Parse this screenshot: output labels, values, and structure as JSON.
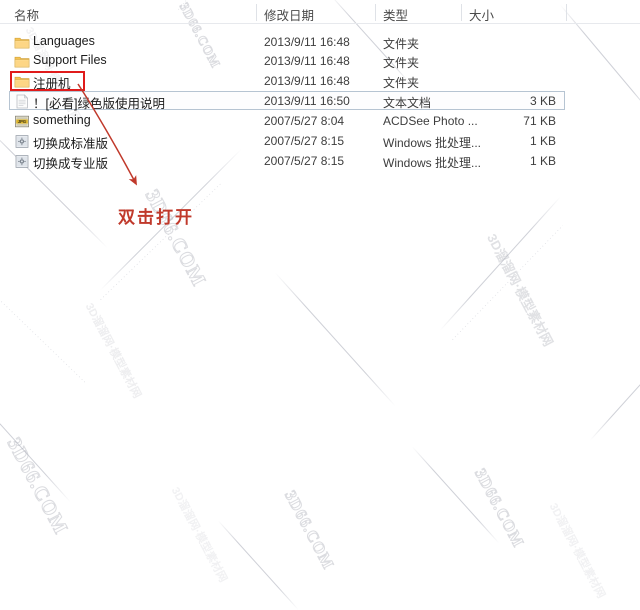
{
  "window": {
    "title": "Windows Explorer file list"
  },
  "columns": [
    {
      "key": "name",
      "label": "名称"
    },
    {
      "key": "date",
      "label": "修改日期"
    },
    {
      "key": "type",
      "label": "类型"
    },
    {
      "key": "size",
      "label": "大小"
    }
  ],
  "rows": [
    {
      "icon": "folder-icon",
      "name": "Languages",
      "date": "2013/9/11 16:48",
      "type": "文件夹",
      "size": "",
      "selected": false
    },
    {
      "icon": "folder-icon",
      "name": "Support Files",
      "date": "2013/9/11 16:48",
      "type": "文件夹",
      "size": "",
      "selected": false
    },
    {
      "icon": "folder-icon",
      "name": "注册机",
      "date": "2013/9/11 16:48",
      "type": "文件夹",
      "size": "",
      "selected": false
    },
    {
      "icon": "text-file-icon",
      "name": "！[必看]绿色版使用说明",
      "date": "2013/9/11 16:50",
      "type": "文本文档",
      "size": "3 KB",
      "selected": true
    },
    {
      "icon": "jpg-image-icon",
      "name": "something",
      "date": "2007/5/27 8:04",
      "type": "ACDSee Photo ...",
      "size": "71 KB",
      "selected": false
    },
    {
      "icon": "batch-file-icon",
      "name": "切换成标准版",
      "date": "2007/5/27 8:15",
      "type": "Windows 批处理...",
      "size": "1 KB",
      "selected": false
    },
    {
      "icon": "batch-file-icon",
      "name": "切换成专业版",
      "date": "2007/5/27 8:15",
      "type": "Windows 批处理...",
      "size": "1 KB",
      "selected": false
    }
  ],
  "annotation": {
    "callout_text": "双击打开",
    "highlight_target": "注册机",
    "color": "#c0392b",
    "box_color": "#e01b1b"
  },
  "watermark": {
    "text_latin": "3D66.COM",
    "text_cn": "3D溜溜网·模型素材网",
    "color": "#aaacb4"
  }
}
